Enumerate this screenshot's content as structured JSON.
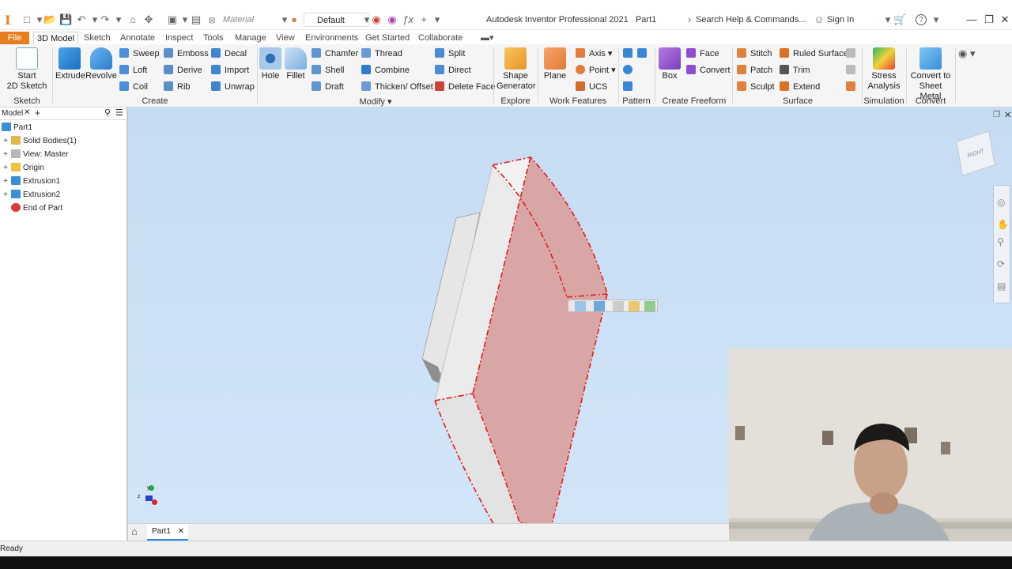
{
  "title_bar": {
    "app_title": "Autodesk Inventor Professional 2021",
    "doc_title": "Part1",
    "material_placeholder": "Material",
    "appearance_value": "Default",
    "search_placeholder": "Search Help & Commands...",
    "sign_in": "Sign In",
    "help": "?"
  },
  "menu": {
    "tabs": [
      "File",
      "3D Model",
      "Sketch",
      "Annotate",
      "Inspect",
      "Tools",
      "Manage",
      "View",
      "Environments",
      "Get Started",
      "Collaborate"
    ],
    "active": "3D Model"
  },
  "ribbon": {
    "sketch": {
      "label": "Sketch",
      "start_sketch": "Start\n2D Sketch"
    },
    "create": {
      "label": "Create",
      "extrude": "Extrude",
      "revolve": "Revolve",
      "sweep": "Sweep",
      "loft": "Loft",
      "coil": "Coil",
      "emboss": "Emboss",
      "derive": "Derive",
      "rib": "Rib",
      "decal": "Decal",
      "import": "Import",
      "unwrap": "Unwrap"
    },
    "modify": {
      "label": "Modify",
      "hole": "Hole",
      "fillet": "Fillet",
      "chamfer": "Chamfer",
      "shell": "Shell",
      "draft": "Draft",
      "thread": "Thread",
      "combine": "Combine",
      "thicken": "Thicken/ Offset",
      "split": "Split",
      "direct": "Direct",
      "delete_face": "Delete Face"
    },
    "explore": {
      "label": "Explore",
      "shape_generator": "Shape\nGenerator"
    },
    "work_features": {
      "label": "Work Features",
      "plane": "Plane",
      "axis": "Axis",
      "point": "Point",
      "ucs": "UCS"
    },
    "pattern": {
      "label": "Pattern"
    },
    "freeform": {
      "label": "Create Freeform",
      "box": "Box",
      "face": "Face",
      "convert": "Convert"
    },
    "surface": {
      "label": "Surface",
      "stitch": "Stitch",
      "patch": "Patch",
      "sculpt": "Sculpt",
      "ruled": "Ruled Surface",
      "trim": "Trim",
      "extend": "Extend"
    },
    "simulation": {
      "label": "Simulation",
      "stress": "Stress\nAnalysis"
    },
    "convert": {
      "label": "Convert",
      "sheet_metal": "Convert to\nSheet Metal"
    }
  },
  "browser": {
    "tab_label": "Model",
    "items": [
      {
        "label": "Part1",
        "expand": ""
      },
      {
        "label": "Solid Bodies(1)",
        "expand": "+"
      },
      {
        "label": "View: Master",
        "expand": "+"
      },
      {
        "label": "Origin",
        "expand": "+"
      },
      {
        "label": "Extrusion1",
        "expand": "+"
      },
      {
        "label": "Extrusion2",
        "expand": "+"
      },
      {
        "label": "End of Part",
        "expand": ""
      }
    ]
  },
  "viewcube": {
    "face_label": "RIGHT"
  },
  "triad": {
    "y": "y",
    "z": "z"
  },
  "doc_tabs": [
    {
      "label": "Part1"
    }
  ],
  "status": {
    "text": "Ready"
  },
  "colors": {
    "file_tab": "#e87d1e",
    "viewport_top": "#c6dcf3",
    "selection": "#e21b1b",
    "face_fill": "#d9a6a6"
  }
}
